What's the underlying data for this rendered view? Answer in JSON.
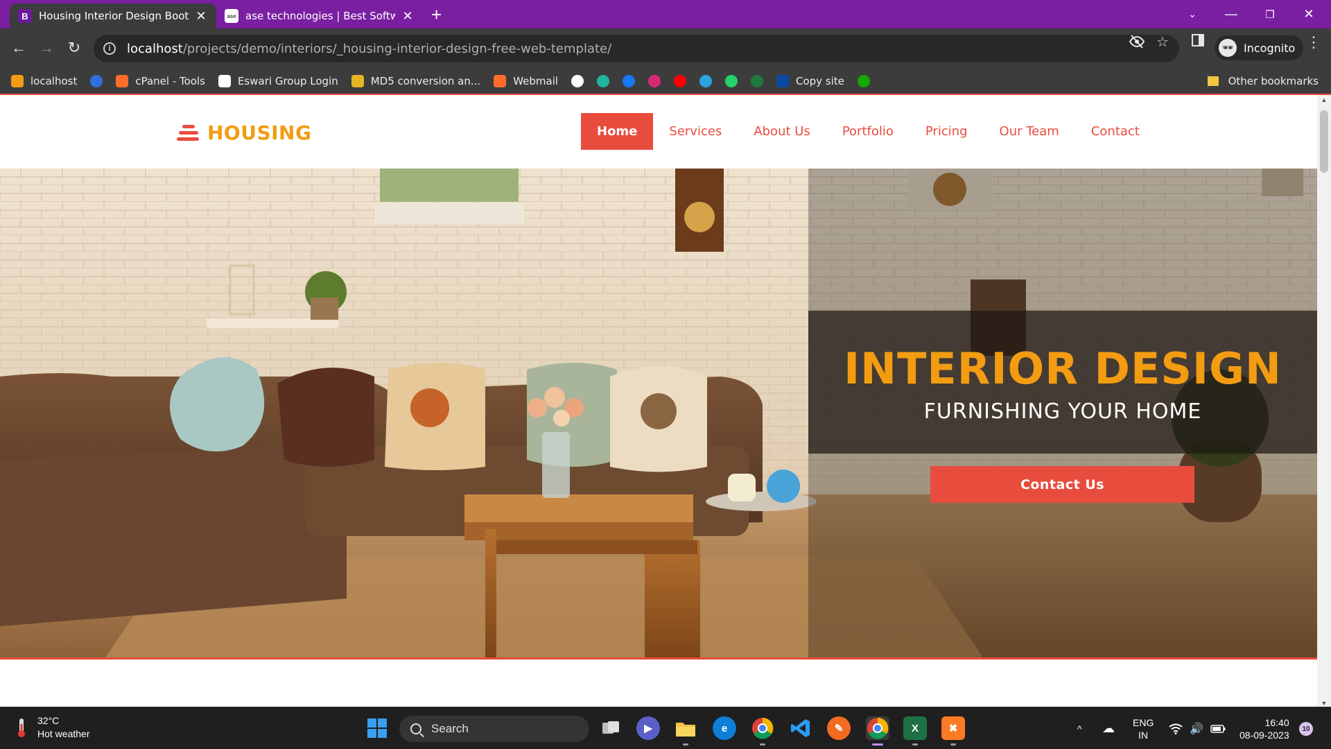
{
  "browser": {
    "tabs": [
      {
        "favicon": "B",
        "title": "Housing Interior Design Bootstra",
        "active": true
      },
      {
        "favicon": "ase",
        "title": "ase technologies | Best Software",
        "active": false
      }
    ],
    "new_tab_icon": "plus-icon",
    "address": {
      "host": "localhost",
      "path": "/projects/demo/interiors/_housing-interior-design-free-web-template/"
    },
    "profile_label": "Incognito",
    "bookmarks": [
      {
        "label": "localhost",
        "icon": "xampp-icon",
        "color": "#f39c12"
      },
      {
        "label": "",
        "icon": "f-logo-icon",
        "color": "#2f6fde"
      },
      {
        "label": "cPanel - Tools",
        "icon": "cpanel-icon",
        "color": "#ff6c2c"
      },
      {
        "label": "Eswari Group Login",
        "icon": "eswari-icon",
        "color": "#ffffff"
      },
      {
        "label": "MD5 conversion an...",
        "icon": "key-icon",
        "color": "#e6b422"
      },
      {
        "label": "Webmail",
        "icon": "cpanel-icon",
        "color": "#ff6c2c"
      },
      {
        "label": "",
        "icon": "github-icon",
        "color": "#ffffff"
      },
      {
        "label": "",
        "icon": "diamond-icon",
        "color": "#1fb59a"
      },
      {
        "label": "",
        "icon": "facebook-icon",
        "color": "#1877f2"
      },
      {
        "label": "",
        "icon": "instagram-icon",
        "color": "#d62976"
      },
      {
        "label": "",
        "icon": "youtube-icon",
        "color": "#ff0000"
      },
      {
        "label": "",
        "icon": "telegram-icon",
        "color": "#2aa3df"
      },
      {
        "label": "",
        "icon": "whatsapp-icon",
        "color": "#25d366"
      },
      {
        "label": "",
        "icon": "sheet-icon",
        "color": "#1e7a3e"
      },
      {
        "label": "Copy site",
        "icon": "w-icon",
        "color": "#0b4aa2"
      },
      {
        "label": "",
        "icon": "upwork-icon",
        "color": "#14a800"
      }
    ],
    "other_bookmarks": "Other bookmarks"
  },
  "site": {
    "logo_text": "HOUSING",
    "nav": [
      {
        "label": "Home",
        "active": true
      },
      {
        "label": "Services",
        "active": false
      },
      {
        "label": "About Us",
        "active": false
      },
      {
        "label": "Portfolio",
        "active": false
      },
      {
        "label": "Pricing",
        "active": false
      },
      {
        "label": "Our Team",
        "active": false
      },
      {
        "label": "Contact",
        "active": false
      }
    ],
    "hero": {
      "title": "INTERIOR DESIGN",
      "subtitle": "FURNISHING YOUR HOME",
      "button": "Contact Us"
    },
    "colors": {
      "accent": "#e84c3d",
      "brand": "#f39c12"
    }
  },
  "taskbar": {
    "weather_temp": "32°C",
    "weather_desc": "Hot weather",
    "search_placeholder": "Search",
    "lang_1": "ENG",
    "lang_2": "IN",
    "time": "16:40",
    "date": "08-09-2023",
    "notifications": "10"
  }
}
